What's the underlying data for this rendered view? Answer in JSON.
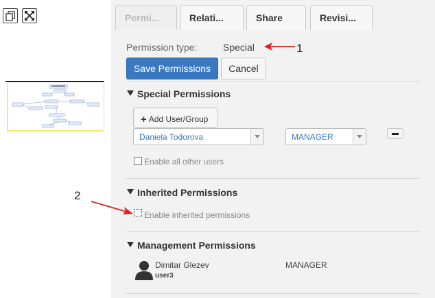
{
  "toolbar": {
    "restore_icon": "window-restore-icon",
    "fullscreen_icon": "expand-arrows-icon"
  },
  "tabs": [
    {
      "label": "Permi...",
      "active": true
    },
    {
      "label": "Relati...",
      "active": false
    },
    {
      "label": "Share",
      "active": false
    },
    {
      "label": "Revisi...",
      "active": false
    }
  ],
  "permission_type": {
    "label": "Permission type:",
    "value": "Special"
  },
  "buttons": {
    "save": "Save Permissions",
    "cancel": "Cancel"
  },
  "special": {
    "title": "Special Permissions",
    "add_button": "Add User/Group",
    "user_select": "Daniela Todorova",
    "role_select": "MANAGER",
    "enable_all_label": "Enable all other users"
  },
  "inherited": {
    "title": "Inherited Permissions",
    "enable_label": "Enable inherited permissions"
  },
  "management": {
    "title": "Management Permissions",
    "entries": [
      {
        "name": "Dimitar Glezev",
        "username": "user3",
        "role": "MANAGER"
      }
    ]
  },
  "annotations": {
    "one": "1",
    "two": "2",
    "arrow_color": "#e02020"
  },
  "colors": {
    "primary": "#3a79c1",
    "panel_bg": "#f2f2f2"
  }
}
